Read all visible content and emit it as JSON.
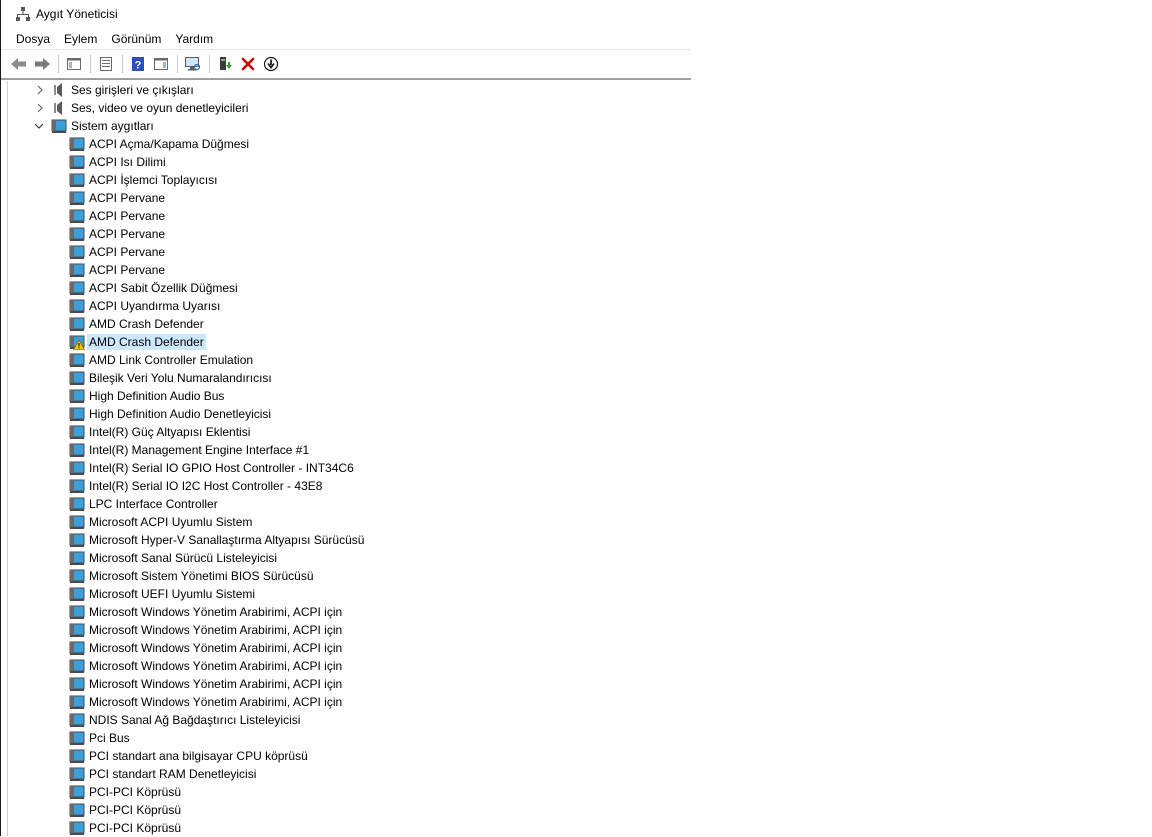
{
  "window": {
    "title": "Aygıt Yöneticisi"
  },
  "menubar": {
    "items": [
      "Dosya",
      "Eylem",
      "Görünüm",
      "Yardım"
    ]
  },
  "toolbar": {
    "buttons": [
      {
        "icon": "back-arrow-icon"
      },
      {
        "icon": "forward-arrow-icon"
      },
      {
        "icon": "show-hide-console-tree-icon"
      },
      {
        "icon": "properties-icon"
      },
      {
        "icon": "help-icon"
      },
      {
        "icon": "action-pane-icon"
      },
      {
        "icon": "scan-hardware-icon"
      },
      {
        "icon": "update-driver-icon"
      },
      {
        "icon": "uninstall-device-icon"
      },
      {
        "icon": "disable-device-icon"
      }
    ]
  },
  "tree": {
    "categories": [
      {
        "label": "Ses girişleri ve çıkışları",
        "expanded": false
      },
      {
        "label": "Ses, video ve oyun denetleyicileri",
        "expanded": false
      },
      {
        "label": "Sistem aygıtları",
        "expanded": true
      }
    ],
    "devices": [
      {
        "label": "ACPI Açma/Kapama Düğmesi"
      },
      {
        "label": "ACPI Isı Dilimi"
      },
      {
        "label": "ACPI İşlemci Toplayıcısı"
      },
      {
        "label": "ACPI Pervane"
      },
      {
        "label": "ACPI Pervane"
      },
      {
        "label": "ACPI Pervane"
      },
      {
        "label": "ACPI Pervane"
      },
      {
        "label": "ACPI Pervane"
      },
      {
        "label": "ACPI Sabit Özellik Düğmesi"
      },
      {
        "label": "ACPI Uyandırma Uyarısı"
      },
      {
        "label": "AMD Crash Defender"
      },
      {
        "label": "AMD Crash Defender",
        "selected": true,
        "warning": true
      },
      {
        "label": "AMD Link Controller Emulation"
      },
      {
        "label": "Bileşik Veri Yolu Numaralandırıcısı"
      },
      {
        "label": "High Definition Audio Bus"
      },
      {
        "label": "High Definition Audio Denetleyicisi"
      },
      {
        "label": "Intel(R) Güç Altyapısı Eklentisi"
      },
      {
        "label": "Intel(R) Management Engine Interface #1"
      },
      {
        "label": "Intel(R) Serial IO GPIO Host Controller - INT34C6"
      },
      {
        "label": "Intel(R) Serial IO I2C Host Controller - 43E8"
      },
      {
        "label": "LPC Interface Controller"
      },
      {
        "label": "Microsoft ACPI Uyumlu Sistem"
      },
      {
        "label": "Microsoft Hyper-V Sanallaştırma Altyapısı Sürücüsü"
      },
      {
        "label": "Microsoft Sanal Sürücü Listeleyicisi"
      },
      {
        "label": "Microsoft Sistem Yönetimi BIOS Sürücüsü"
      },
      {
        "label": "Microsoft UEFI Uyumlu Sistemi"
      },
      {
        "label": "Microsoft Windows Yönetim Arabirimi, ACPI için"
      },
      {
        "label": "Microsoft Windows Yönetim Arabirimi, ACPI için"
      },
      {
        "label": "Microsoft Windows Yönetim Arabirimi, ACPI için"
      },
      {
        "label": "Microsoft Windows Yönetim Arabirimi, ACPI için"
      },
      {
        "label": "Microsoft Windows Yönetim Arabirimi, ACPI için"
      },
      {
        "label": "Microsoft Windows Yönetim Arabirimi, ACPI için"
      },
      {
        "label": "NDIS Sanal Ağ Bağdaştırıcı Listeleyicisi"
      },
      {
        "label": "Pci Bus"
      },
      {
        "label": "PCI standart ana bilgisayar CPU köprüsü"
      },
      {
        "label": "PCI standart RAM Denetleyicisi"
      },
      {
        "label": "PCI-PCI Köprüsü"
      },
      {
        "label": "PCI-PCI Köprüsü"
      },
      {
        "label": "PCI-PCI Köprüsü"
      }
    ]
  },
  "colors": {
    "selection": "#cce8ff",
    "device_icon_blue": "#3aa0dc",
    "warning_yellow": "#f5c400",
    "uninstall_red": "#d40000"
  }
}
